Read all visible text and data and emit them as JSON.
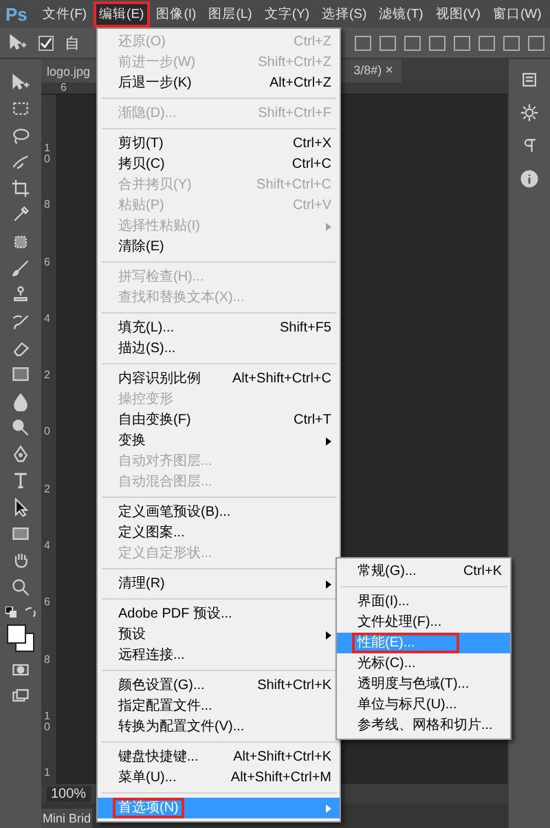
{
  "menubar": {
    "logo": "Ps",
    "items": [
      {
        "label": "文件(F)",
        "selected": false,
        "annotated": false
      },
      {
        "label": "编辑(E)",
        "selected": true,
        "annotated": true
      },
      {
        "label": "图像(I)",
        "selected": false,
        "annotated": false
      },
      {
        "label": "图层(L)",
        "selected": false,
        "annotated": false
      },
      {
        "label": "文字(Y)",
        "selected": false,
        "annotated": false
      },
      {
        "label": "选择(S)",
        "selected": false,
        "annotated": false
      },
      {
        "label": "滤镜(T)",
        "selected": false,
        "annotated": false
      },
      {
        "label": "视图(V)",
        "selected": false,
        "annotated": false
      },
      {
        "label": "窗口(W)",
        "selected": false,
        "annotated": false
      }
    ]
  },
  "options_bar": {
    "auto_select": {
      "label": "自",
      "checked": true
    }
  },
  "document_tab": {
    "title_start": "logo.jpg",
    "title_end": "3/8#)",
    "close": "×"
  },
  "rulers": {
    "top_labels": [
      "6"
    ],
    "left_labels": [
      "10",
      "8",
      "6",
      "4",
      "2",
      "0",
      "2",
      "4",
      "6",
      "8",
      "10",
      "1"
    ]
  },
  "status_bar": {
    "zoom": "100%"
  },
  "panel_tab": "Mini Brid",
  "edit_menu": {
    "groups": [
      [
        {
          "label": "还原(O)",
          "shortcut": "Ctrl+Z",
          "disabled": true,
          "submenu": false,
          "highlighted": false,
          "annotated": false
        },
        {
          "label": "前进一步(W)",
          "shortcut": "Shift+Ctrl+Z",
          "disabled": true,
          "submenu": false,
          "highlighted": false,
          "annotated": false
        },
        {
          "label": "后退一步(K)",
          "shortcut": "Alt+Ctrl+Z",
          "disabled": false,
          "submenu": false,
          "highlighted": false,
          "annotated": false
        }
      ],
      [
        {
          "label": "渐隐(D)...",
          "shortcut": "Shift+Ctrl+F",
          "disabled": true,
          "submenu": false,
          "highlighted": false,
          "annotated": false
        }
      ],
      [
        {
          "label": "剪切(T)",
          "shortcut": "Ctrl+X",
          "disabled": false,
          "submenu": false,
          "highlighted": false,
          "annotated": false
        },
        {
          "label": "拷贝(C)",
          "shortcut": "Ctrl+C",
          "disabled": false,
          "submenu": false,
          "highlighted": false,
          "annotated": false
        },
        {
          "label": "合并拷贝(Y)",
          "shortcut": "Shift+Ctrl+C",
          "disabled": true,
          "submenu": false,
          "highlighted": false,
          "annotated": false
        },
        {
          "label": "粘贴(P)",
          "shortcut": "Ctrl+V",
          "disabled": true,
          "submenu": false,
          "highlighted": false,
          "annotated": false
        },
        {
          "label": "选择性粘贴(I)",
          "disabled": true,
          "submenu": true,
          "highlighted": false,
          "annotated": false
        },
        {
          "label": "清除(E)",
          "disabled": false,
          "submenu": false,
          "highlighted": false,
          "annotated": false
        }
      ],
      [
        {
          "label": "拼写检查(H)...",
          "disabled": true,
          "submenu": false,
          "highlighted": false,
          "annotated": false
        },
        {
          "label": "查找和替换文本(X)...",
          "disabled": true,
          "submenu": false,
          "highlighted": false,
          "annotated": false
        }
      ],
      [
        {
          "label": "填充(L)...",
          "shortcut": "Shift+F5",
          "disabled": false,
          "submenu": false,
          "highlighted": false,
          "annotated": false
        },
        {
          "label": "描边(S)...",
          "disabled": false,
          "submenu": false,
          "highlighted": false,
          "annotated": false
        }
      ],
      [
        {
          "label": "内容识别比例",
          "shortcut": "Alt+Shift+Ctrl+C",
          "disabled": false,
          "submenu": false,
          "highlighted": false,
          "annotated": false
        },
        {
          "label": "操控变形",
          "disabled": true,
          "submenu": false,
          "highlighted": false,
          "annotated": false
        },
        {
          "label": "自由变换(F)",
          "shortcut": "Ctrl+T",
          "disabled": false,
          "submenu": false,
          "highlighted": false,
          "annotated": false
        },
        {
          "label": "变换",
          "disabled": false,
          "submenu": true,
          "highlighted": false,
          "annotated": false
        },
        {
          "label": "自动对齐图层...",
          "disabled": true,
          "submenu": false,
          "highlighted": false,
          "annotated": false
        },
        {
          "label": "自动混合图层...",
          "disabled": true,
          "submenu": false,
          "highlighted": false,
          "annotated": false
        }
      ],
      [
        {
          "label": "定义画笔预设(B)...",
          "disabled": false,
          "submenu": false,
          "highlighted": false,
          "annotated": false
        },
        {
          "label": "定义图案...",
          "disabled": false,
          "submenu": false,
          "highlighted": false,
          "annotated": false
        },
        {
          "label": "定义自定形状...",
          "disabled": true,
          "submenu": false,
          "highlighted": false,
          "annotated": false
        }
      ],
      [
        {
          "label": "清理(R)",
          "disabled": false,
          "submenu": true,
          "highlighted": false,
          "annotated": false
        }
      ],
      [
        {
          "label": "Adobe PDF 预设...",
          "disabled": false,
          "submenu": false,
          "highlighted": false,
          "annotated": false
        },
        {
          "label": "预设",
          "disabled": false,
          "submenu": true,
          "highlighted": false,
          "annotated": false
        },
        {
          "label": "远程连接...",
          "disabled": false,
          "submenu": false,
          "highlighted": false,
          "annotated": false
        }
      ],
      [
        {
          "label": "颜色设置(G)...",
          "shortcut": "Shift+Ctrl+K",
          "disabled": false,
          "submenu": false,
          "highlighted": false,
          "annotated": false
        },
        {
          "label": "指定配置文件...",
          "disabled": false,
          "submenu": false,
          "highlighted": false,
          "annotated": false
        },
        {
          "label": "转换为配置文件(V)...",
          "disabled": false,
          "submenu": false,
          "highlighted": false,
          "annotated": false
        }
      ],
      [
        {
          "label": "键盘快捷键...",
          "shortcut": "Alt+Shift+Ctrl+K",
          "disabled": false,
          "submenu": false,
          "highlighted": false,
          "annotated": false
        },
        {
          "label": "菜单(U)...",
          "shortcut": "Alt+Shift+Ctrl+M",
          "disabled": false,
          "submenu": false,
          "highlighted": false,
          "annotated": false
        }
      ],
      [
        {
          "label": "首选项(N)",
          "disabled": false,
          "submenu": true,
          "highlighted": true,
          "annotated": true
        }
      ]
    ]
  },
  "preferences_submenu": {
    "groups": [
      [
        {
          "label": "常规(G)...",
          "shortcut": "Ctrl+K",
          "disabled": false,
          "submenu": false,
          "highlighted": false,
          "annotated": false
        }
      ],
      [
        {
          "label": "界面(I)...",
          "disabled": false,
          "submenu": false,
          "highlighted": false,
          "annotated": false
        },
        {
          "label": "文件处理(F)...",
          "disabled": false,
          "submenu": false,
          "highlighted": false,
          "annotated": false
        },
        {
          "label": "性能(E)...",
          "disabled": false,
          "submenu": false,
          "highlighted": true,
          "annotated": true
        },
        {
          "label": "光标(C)...",
          "disabled": false,
          "submenu": false,
          "highlighted": false,
          "annotated": false
        },
        {
          "label": "透明度与色域(T)...",
          "disabled": false,
          "submenu": false,
          "highlighted": false,
          "annotated": false
        },
        {
          "label": "单位与标尺(U)...",
          "disabled": false,
          "submenu": false,
          "highlighted": false,
          "annotated": false
        },
        {
          "label": "参考线、网格和切片...",
          "disabled": false,
          "submenu": false,
          "highlighted": false,
          "annotated": false
        }
      ]
    ]
  }
}
